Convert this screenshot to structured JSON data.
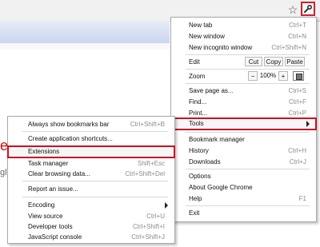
{
  "toolbar": {
    "star_icon": "star-icon",
    "wrench_icon": "wrench-icon"
  },
  "page": {
    "fragment_red": "e",
    "fragment_gray": "gle"
  },
  "main_menu": {
    "new_tab": {
      "label": "New tab",
      "shortcut": "Ctrl+T"
    },
    "new_window": {
      "label": "New window",
      "shortcut": "Ctrl+N"
    },
    "new_incognito": {
      "label": "New incognito window",
      "shortcut": "Ctrl+Shift+N"
    },
    "edit": {
      "label": "Edit",
      "cut": "Cut",
      "copy": "Copy",
      "paste": "Paste"
    },
    "zoom": {
      "label": "Zoom",
      "minus": "−",
      "value": "100%",
      "plus": "+"
    },
    "save_page": {
      "label": "Save page as...",
      "shortcut": "Ctrl+S"
    },
    "find": {
      "label": "Find...",
      "shortcut": "Ctrl+F"
    },
    "print": {
      "label": "Print...",
      "shortcut": "Ctrl+P"
    },
    "tools": {
      "label": "Tools"
    },
    "bookmark_manager": {
      "label": "Bookmark manager"
    },
    "history": {
      "label": "History",
      "shortcut": "Ctrl+H"
    },
    "downloads": {
      "label": "Downloads",
      "shortcut": "Ctrl+J"
    },
    "options": {
      "label": "Options"
    },
    "about": {
      "label": "About Google Chrome"
    },
    "help": {
      "label": "Help",
      "shortcut": "F1"
    },
    "exit": {
      "label": "Exit"
    }
  },
  "tools_menu": {
    "show_bookmarks_bar": {
      "label": "Always show bookmarks bar",
      "shortcut": "Ctrl+Shift+B"
    },
    "create_shortcuts": {
      "label": "Create application shortcuts..."
    },
    "extensions": {
      "label": "Extensions"
    },
    "task_manager": {
      "label": "Task manager",
      "shortcut": "Shift+Esc"
    },
    "clear_browsing": {
      "label": "Clear browsing data...",
      "shortcut": "Ctrl+Shift+Del"
    },
    "report_issue": {
      "label": "Report an issue..."
    },
    "encoding": {
      "label": "Encoding"
    },
    "view_source": {
      "label": "View source",
      "shortcut": "Ctrl+U"
    },
    "developer_tools": {
      "label": "Developer tools",
      "shortcut": "Ctrl+Shift+I"
    },
    "javascript_console": {
      "label": "JavaScript console",
      "shortcut": "Ctrl+Shift+J"
    }
  },
  "colors": {
    "highlight_border": "#cc0d25"
  }
}
